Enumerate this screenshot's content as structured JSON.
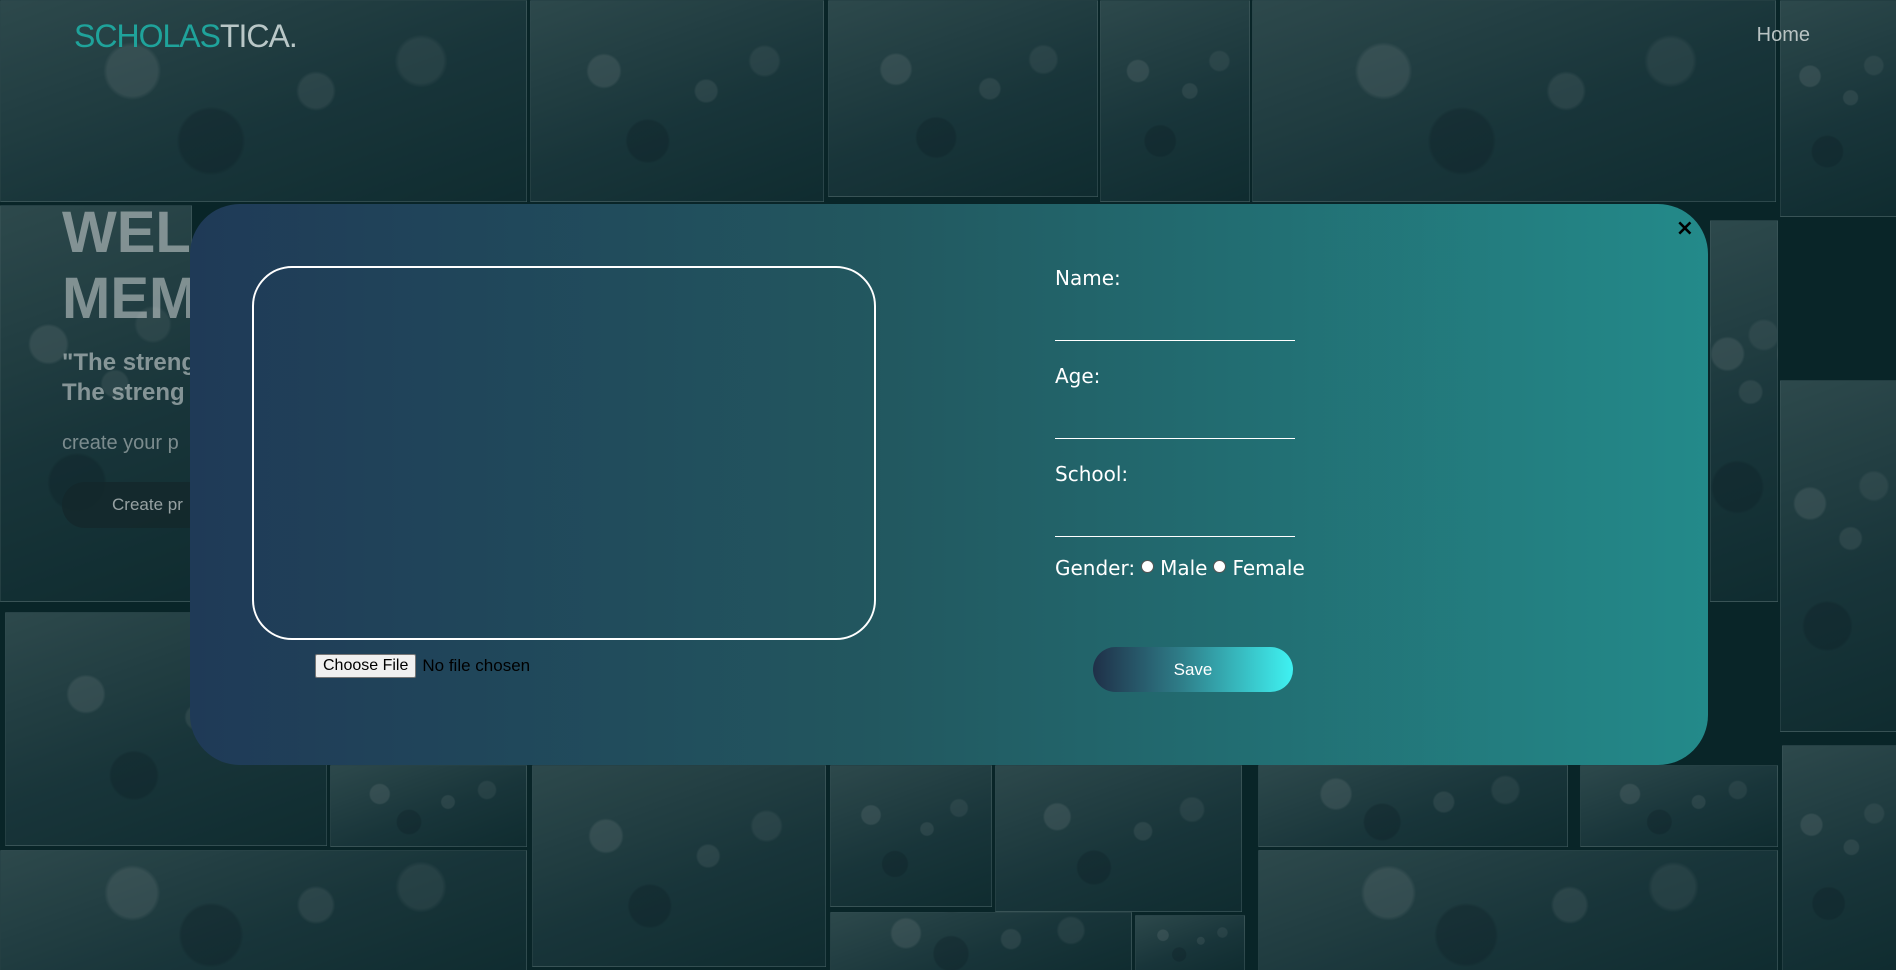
{
  "nav": {
    "brand_part1": "SCHOLAS",
    "brand_part2": "TICA.",
    "home_label": "Home"
  },
  "hero": {
    "title_line1": "WEL",
    "title_line2": "MEM",
    "quote_line1": "\"The streng",
    "quote_line2": "The streng",
    "subtitle": "create your p",
    "button_label": "Create pr"
  },
  "modal": {
    "close_symbol": "×",
    "file_button_label": "Choose File",
    "file_status": "No file chosen",
    "name_label": "Name:",
    "age_label": "Age:",
    "school_label": "School:",
    "gender_label": "Gender:",
    "gender_options": [
      "Male",
      "Female"
    ],
    "save_label": "Save"
  },
  "colors": {
    "brand_accent": "#1fa39b",
    "modal_gradient_start": "#1f3a57",
    "modal_gradient_end": "#238a8a",
    "save_gradient_end": "#3ff2f2"
  }
}
